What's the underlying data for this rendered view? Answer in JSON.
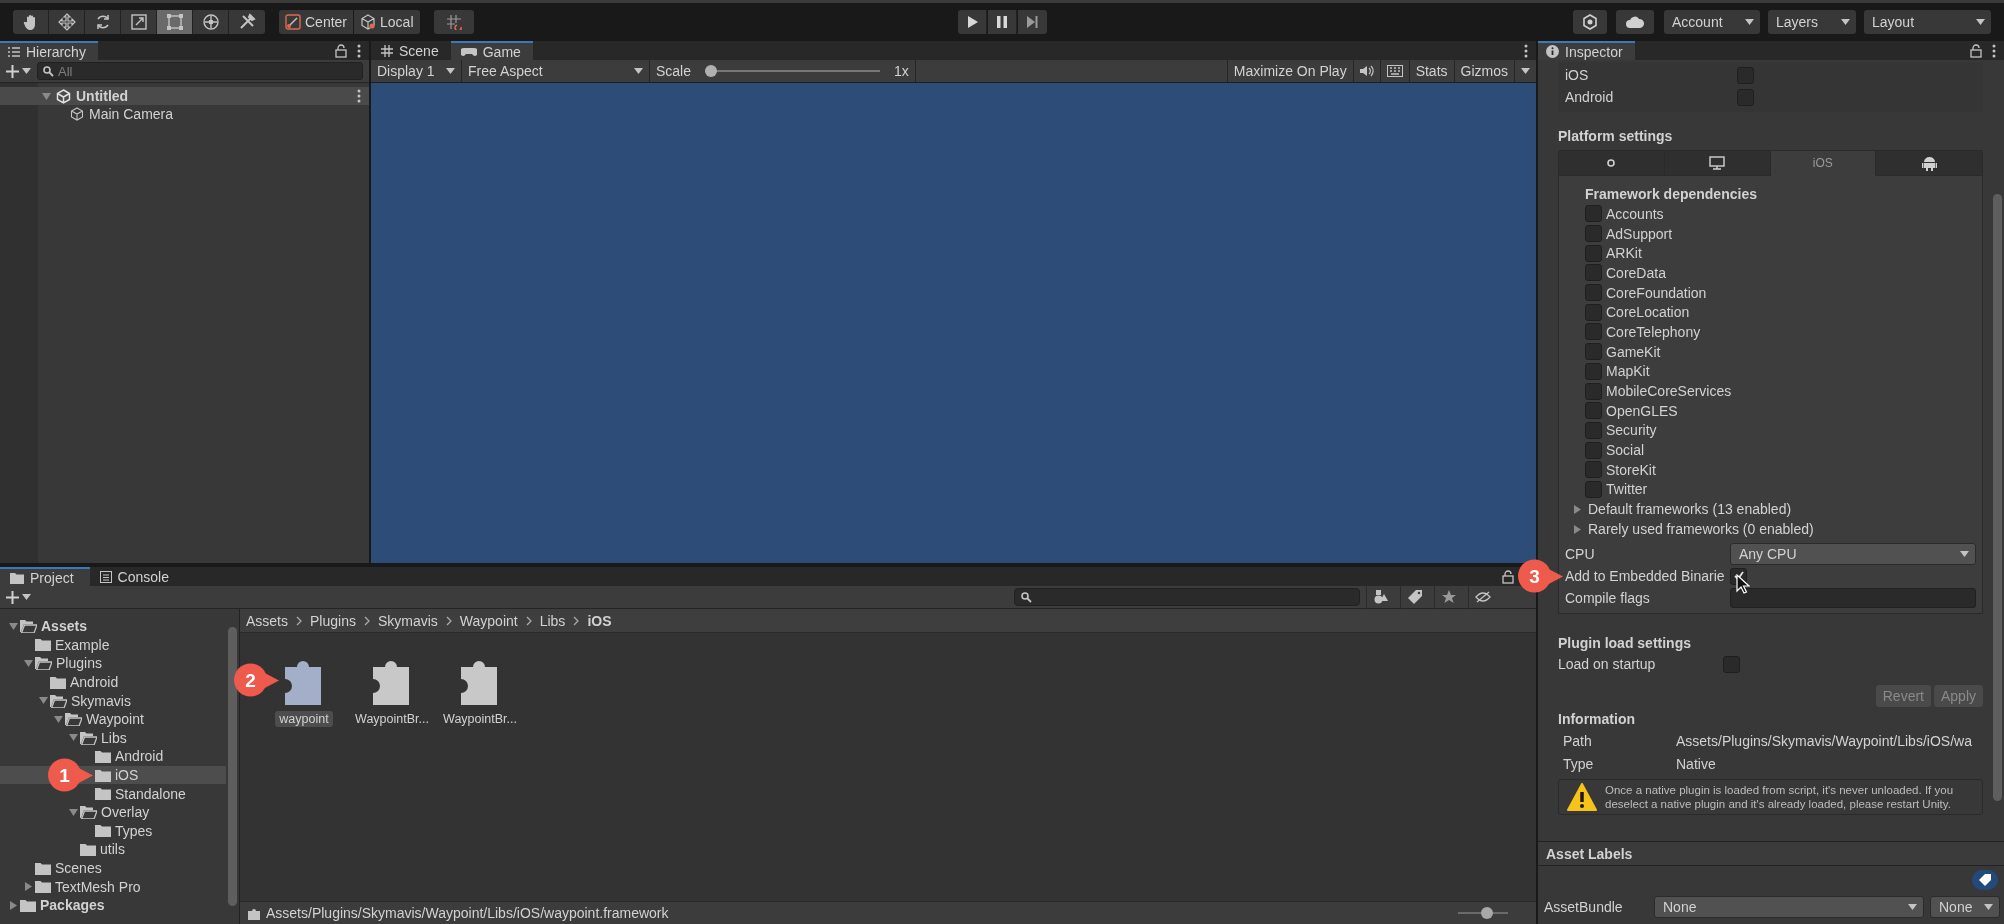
{
  "toolbar": {
    "tools": [
      {
        "selected": false
      },
      {
        "selected": false
      },
      {
        "selected": false
      },
      {
        "selected": false
      },
      {
        "selected": true
      },
      {
        "selected": false
      },
      {
        "selected": false
      }
    ],
    "pivot": "Center",
    "handle_space": "Local",
    "account": "Account",
    "layers": "Layers",
    "layout": "Layout"
  },
  "hierarchy": {
    "title": "Hierarchy",
    "search_placeholder": "All",
    "scenes": [
      {
        "label": "Untitled",
        "expanded": true,
        "children": [
          {
            "label": "Main Camera"
          }
        ]
      }
    ]
  },
  "game_view": {
    "tabs": [
      {
        "label": "Scene",
        "selected": false
      },
      {
        "label": "Game",
        "selected": true
      }
    ],
    "display": "Display 1",
    "aspect": "Free Aspect",
    "scale_label": "Scale",
    "scale_slider": {
      "level": 0
    },
    "scale_value": "1x",
    "maximize_on_play": "Maximize On Play",
    "stats": "Stats",
    "gizmos": "Gizmos"
  },
  "project": {
    "tabs": [
      {
        "label": "Project",
        "selected": true
      },
      {
        "label": "Console",
        "selected": false
      }
    ],
    "tree": [
      {
        "label": "Assets",
        "selected": false,
        "expanded": true,
        "children": [
          {
            "label": "Example",
            "selected": false
          },
          {
            "label": "Plugins",
            "selected": false,
            "expanded": true,
            "children": [
              {
                "label": "Android",
                "selected": false
              },
              {
                "label": "Skymavis",
                "selected": false,
                "expanded": true,
                "children": [
                  {
                    "label": "Waypoint",
                    "selected": false,
                    "expanded": true,
                    "children": [
                      {
                        "label": "Libs",
                        "selected": false,
                        "expanded": true,
                        "children": [
                          {
                            "label": "Android",
                            "selected": false
                          },
                          {
                            "label": "iOS",
                            "selected": true,
                            "callout": "1"
                          },
                          {
                            "label": "Standalone",
                            "selected": false
                          }
                        ]
                      },
                      {
                        "label": "Overlay",
                        "selected": false,
                        "expanded": true,
                        "children": [
                          {
                            "label": "Types",
                            "selected": false
                          }
                        ]
                      },
                      {
                        "label": "utils",
                        "selected": false
                      }
                    ]
                  }
                ]
              }
            ]
          },
          {
            "label": "Scenes",
            "selected": false
          },
          {
            "label": "TextMesh Pro",
            "selected": false,
            "expanded": false
          }
        ]
      },
      {
        "label": "Packages",
        "selected": false,
        "expanded": false
      }
    ],
    "breadcrumb": [
      "Assets",
      "Plugins",
      "Skymavis",
      "Waypoint",
      "Libs",
      "iOS"
    ],
    "assets": [
      {
        "label": "waypoint",
        "selected": true,
        "callout": "2"
      },
      {
        "label": "WaypointBr...",
        "selected": false
      },
      {
        "label": "WaypointBr...",
        "selected": false
      }
    ],
    "status_path": "Assets/Plugins/Skymavis/Waypoint/Libs/iOS/waypoint.framework",
    "zoom_slider": {
      "level": 0.6
    }
  },
  "inspector": {
    "title": "Inspector",
    "platforms": [
      {
        "label": "iOS",
        "checked": false
      },
      {
        "label": "Android",
        "checked": false
      }
    ],
    "platform_settings": "Platform settings",
    "platform_tabs": [
      {
        "kind": "icon",
        "selected": false
      },
      {
        "kind": "icon",
        "selected": false
      },
      {
        "kind": "text",
        "label": "iOS",
        "selected": true
      },
      {
        "kind": "icon",
        "selected": false
      }
    ],
    "framework_heading": "Framework dependencies",
    "frameworks": [
      {
        "label": "Accounts",
        "checked": false
      },
      {
        "label": "AdSupport",
        "checked": false
      },
      {
        "label": "ARKit",
        "checked": false
      },
      {
        "label": "CoreData",
        "checked": false
      },
      {
        "label": "CoreFoundation",
        "checked": false
      },
      {
        "label": "CoreLocation",
        "checked": false
      },
      {
        "label": "CoreTelephony",
        "checked": false
      },
      {
        "label": "GameKit",
        "checked": false
      },
      {
        "label": "MapKit",
        "checked": false
      },
      {
        "label": "MobileCoreServices",
        "checked": false
      },
      {
        "label": "OpenGLES",
        "checked": false
      },
      {
        "label": "Security",
        "checked": false
      },
      {
        "label": "Social",
        "checked": false
      },
      {
        "label": "StoreKit",
        "checked": false
      },
      {
        "label": "Twitter",
        "checked": false
      }
    ],
    "foldouts": [
      {
        "label": "Default frameworks (13 enabled)",
        "expanded": false
      },
      {
        "label": "Rarely used frameworks (0 enabled)",
        "expanded": false
      }
    ],
    "cpu": {
      "label": "CPU",
      "value": "Any CPU"
    },
    "embedded": {
      "label": "Add to Embedded Binarie",
      "checked": true,
      "callout": "3"
    },
    "compile_flags": {
      "label": "Compile flags"
    },
    "plugin_load": {
      "heading": "Plugin load settings",
      "label": "Load on startup",
      "checked": false
    },
    "buttons": [
      {
        "label": "Revert",
        "disabled": true
      },
      {
        "label": "Apply",
        "disabled": true
      }
    ],
    "information": {
      "heading": "Information",
      "rows": [
        {
          "label": "Path",
          "value": "Assets/Plugins/Skymavis/Waypoint/Libs/iOS/wa"
        },
        {
          "label": "Type",
          "value": "Native"
        }
      ],
      "warning": "Once a native plugin is loaded from script, it's never unloaded. If you deselect a native plugin and it's already loaded, please restart Unity."
    },
    "asset_labels": {
      "heading": "Asset Labels",
      "bundle_label": "AssetBundle",
      "bundle": "None",
      "variant": "None"
    }
  }
}
